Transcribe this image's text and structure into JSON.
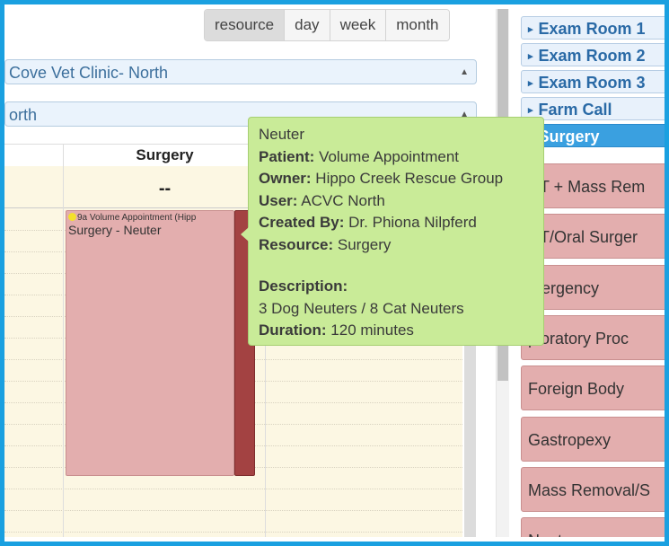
{
  "views": [
    "resource",
    "day",
    "week",
    "month"
  ],
  "clinic_select": "Cove Vet Clinic- North",
  "location_select": "orth",
  "columns": [
    {
      "label": ""
    },
    {
      "label": "Surgery"
    }
  ],
  "allday_placeholder": "--",
  "event": {
    "time_label": "9a Volume Appointment (Hipp",
    "title": "Surgery - Neuter"
  },
  "tooltip": {
    "heading": "Neuter",
    "patient_label": "Patient:",
    "patient": "Volume Appointment",
    "owner_label": "Owner:",
    "owner": "Hippo Creek Rescue Group",
    "user_label": "User:",
    "user": "ACVC North",
    "created_label": "Created By:",
    "created": "Dr. Phiona Nilpferd",
    "resource_label": "Resource:",
    "resource": "Surgery",
    "description_label": "Description:",
    "description": "3 Dog Neuters / 8 Cat Neuters",
    "duration_label": "Duration:",
    "duration": "120 minutes"
  },
  "rooms": [
    "Exam Room 1",
    "Exam Room 2",
    "Exam Room 3",
    "Farm Call",
    "Surgery"
  ],
  "procedures": [
    "NT + Mass Rem",
    "NT/Oral Surger",
    "mergency",
    "ploratory Proc",
    "Foreign Body",
    "Gastropexy",
    "Mass Removal/S",
    "Neuter"
  ],
  "colors": {
    "frame": "#1aa0e0",
    "event": "#e3aeae",
    "tooltip": "#c9eb98",
    "active_room": "#3aa0e0"
  }
}
